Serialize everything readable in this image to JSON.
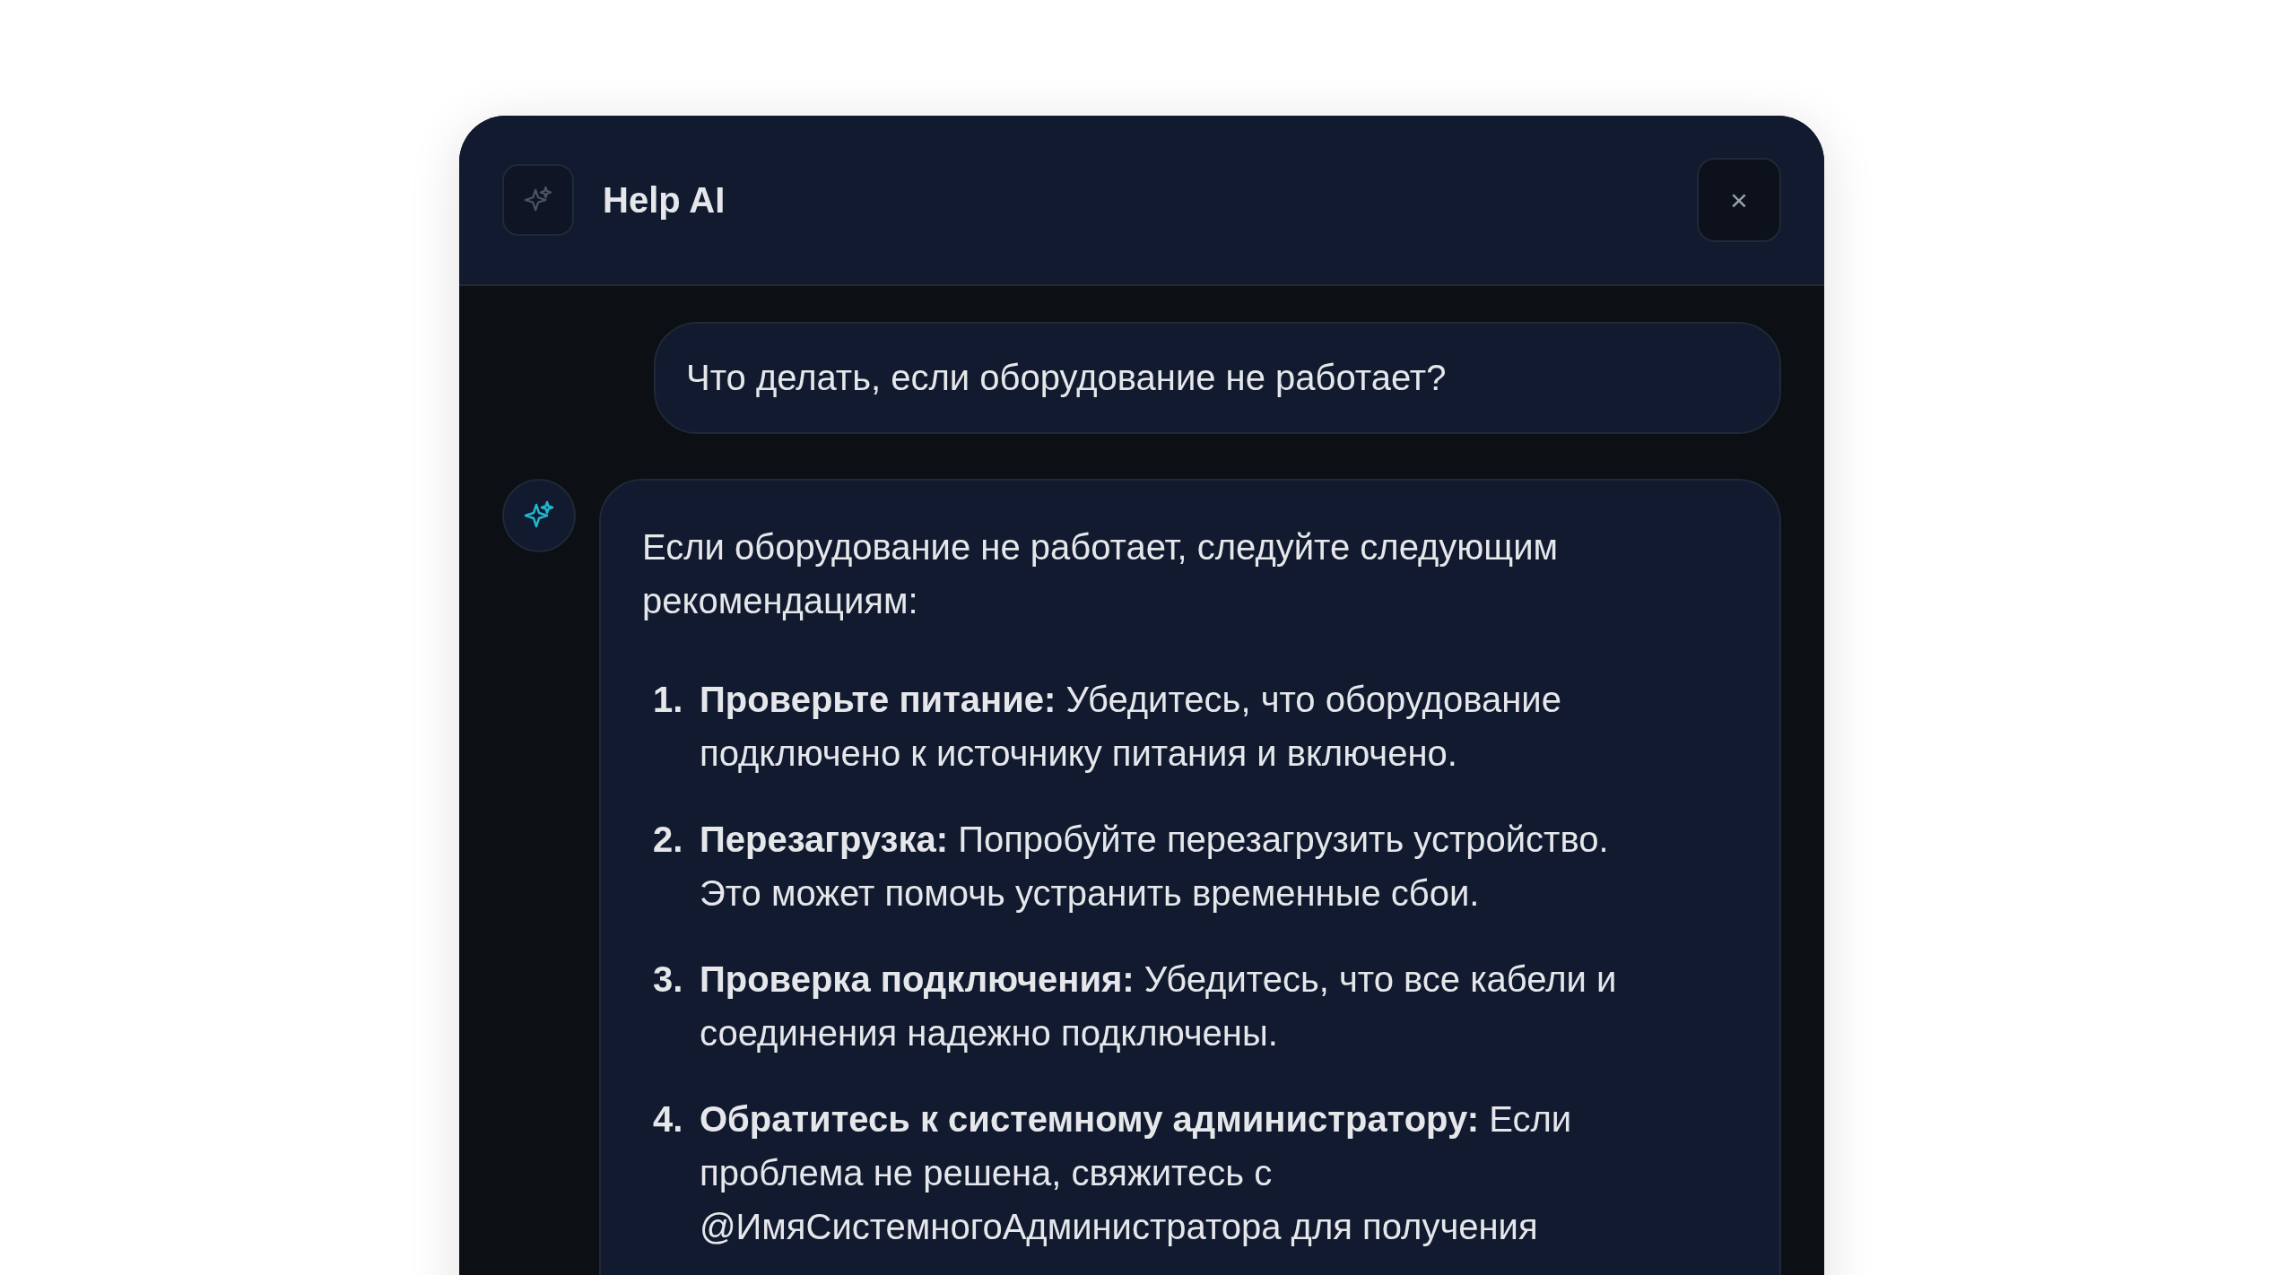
{
  "window": {
    "title": "Help AI",
    "close": "×"
  },
  "messages": [
    {
      "kind": "user",
      "text": "Что делать, если оборудование не работает?"
    },
    {
      "kind": "assistant",
      "intro": "Если оборудование не работает, следуйте следующим рекомендациям:",
      "steps": [
        {
          "number": "1.",
          "text": "**Проверьте питание:** Убедитесь, что оборудование подключено к источнику питания и включено."
        },
        {
          "number": "2.",
          "text": "**Перезагрузка:** Попробуйте перезагрузить устройство. Это может помочь устранить временные сбои."
        },
        {
          "number": "3.",
          "text": "**Проверка подключения:** Убедитесь, что все кабели и соединения надежно подключены."
        },
        {
          "number": "4.",
          "text": "**Обратитесь к системному администратору:** Если проблема не решена, свяжитесь с @ИмяСистемногоАдминистратора для получения"
        }
      ]
    }
  ]
}
